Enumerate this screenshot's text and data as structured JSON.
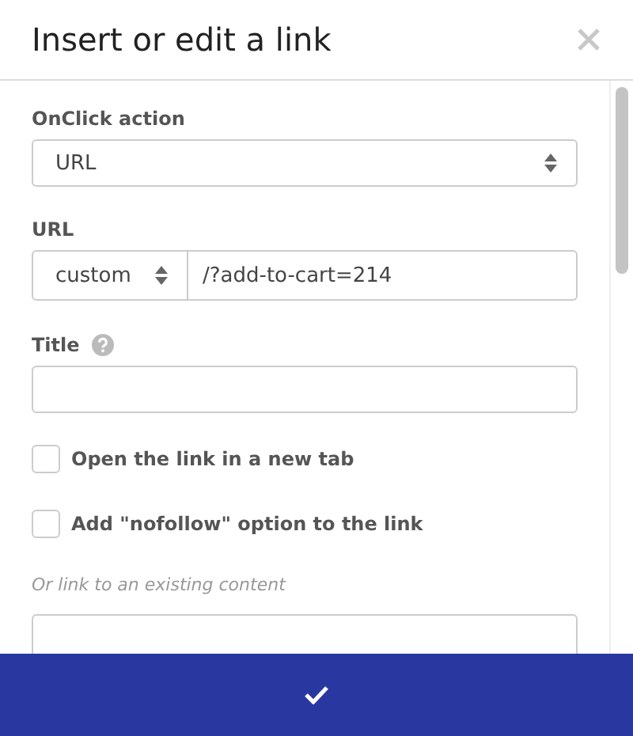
{
  "window": {
    "title": "Insert or edit a link"
  },
  "onclick_action": {
    "label": "OnClick action",
    "value": "URL"
  },
  "url": {
    "label": "URL",
    "type": "custom",
    "value": "/?add-to-cart=214"
  },
  "title_field": {
    "label": "Title"
  },
  "options": [
    {
      "label": "Open the link in a new tab",
      "checked": false
    },
    {
      "label": "Add \"nofollow\" option to the link",
      "checked": false
    }
  ],
  "existing_content": {
    "label": "Or link to an existing content"
  }
}
